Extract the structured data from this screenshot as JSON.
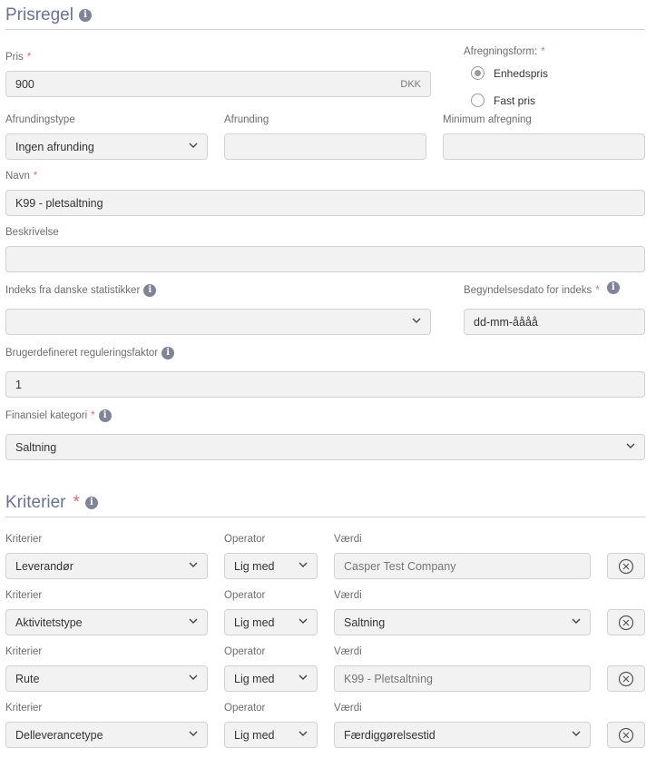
{
  "prisregel": {
    "title": "Prisregel",
    "pris": {
      "label": "Pris",
      "value": "900",
      "suffix": "DKK"
    },
    "afregningsform": {
      "label": "Afregningsform:",
      "options": [
        {
          "label": "Enhedspris",
          "selected": true
        },
        {
          "label": "Fast pris",
          "selected": false
        }
      ]
    },
    "afrundingstype": {
      "label": "Afrundingstype",
      "value": "Ingen afrunding"
    },
    "afrunding": {
      "label": "Afrunding",
      "value": ""
    },
    "minimum_afregning": {
      "label": "Minimum afregning",
      "value": ""
    },
    "navn": {
      "label": "Navn",
      "value": "K99 - pletsaltning"
    },
    "beskrivelse": {
      "label": "Beskrivelse",
      "value": ""
    },
    "indeks": {
      "label": "Indeks fra danske statistikker",
      "value": ""
    },
    "begyndelsesdato": {
      "label": "Begyndelsesdato for indeks",
      "placeholder": "dd-mm-åååå"
    },
    "reguleringsfaktor": {
      "label": "Brugerdefineret reguleringsfaktor",
      "value": "1"
    },
    "finansiel_kategori": {
      "label": "Finansiel kategori",
      "value": "Saltning"
    }
  },
  "kriterier": {
    "title": "Kriterier",
    "labels": {
      "kriterie": "Kriterier",
      "operator": "Operator",
      "vaerdi": "Værdi"
    },
    "rows": [
      {
        "kriterie": "Leverandør",
        "operator": "Lig med",
        "vaerdi": "Casper Test Company",
        "vaerdi_dropdown": false
      },
      {
        "kriterie": "Aktivitetstype",
        "operator": "Lig med",
        "vaerdi": "Saltning",
        "vaerdi_dropdown": true
      },
      {
        "kriterie": "Rute",
        "operator": "Lig med",
        "vaerdi": "K99 - Pletsaltning",
        "vaerdi_dropdown": false
      },
      {
        "kriterie": "Delleverancetype",
        "operator": "Lig med",
        "vaerdi": "Færdiggørelsestid",
        "vaerdi_dropdown": true
      }
    ]
  },
  "colors": {
    "heading": "#6b7290",
    "required": "#e06b6b",
    "info_icon": "#7f8499",
    "field_bg": "#f2f2f2",
    "field_border": "#d2d2d2"
  }
}
